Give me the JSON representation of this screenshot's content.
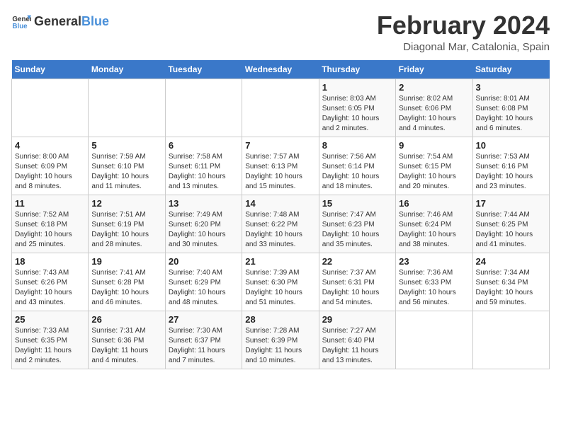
{
  "logo": {
    "general": "General",
    "blue": "Blue"
  },
  "title": "February 2024",
  "subtitle": "Diagonal Mar, Catalonia, Spain",
  "days_of_week": [
    "Sunday",
    "Monday",
    "Tuesday",
    "Wednesday",
    "Thursday",
    "Friday",
    "Saturday"
  ],
  "weeks": [
    [
      {
        "day": "",
        "info": ""
      },
      {
        "day": "",
        "info": ""
      },
      {
        "day": "",
        "info": ""
      },
      {
        "day": "",
        "info": ""
      },
      {
        "day": "1",
        "info": "Sunrise: 8:03 AM\nSunset: 6:05 PM\nDaylight: 10 hours\nand 2 minutes."
      },
      {
        "day": "2",
        "info": "Sunrise: 8:02 AM\nSunset: 6:06 PM\nDaylight: 10 hours\nand 4 minutes."
      },
      {
        "day": "3",
        "info": "Sunrise: 8:01 AM\nSunset: 6:08 PM\nDaylight: 10 hours\nand 6 minutes."
      }
    ],
    [
      {
        "day": "4",
        "info": "Sunrise: 8:00 AM\nSunset: 6:09 PM\nDaylight: 10 hours\nand 8 minutes."
      },
      {
        "day": "5",
        "info": "Sunrise: 7:59 AM\nSunset: 6:10 PM\nDaylight: 10 hours\nand 11 minutes."
      },
      {
        "day": "6",
        "info": "Sunrise: 7:58 AM\nSunset: 6:11 PM\nDaylight: 10 hours\nand 13 minutes."
      },
      {
        "day": "7",
        "info": "Sunrise: 7:57 AM\nSunset: 6:13 PM\nDaylight: 10 hours\nand 15 minutes."
      },
      {
        "day": "8",
        "info": "Sunrise: 7:56 AM\nSunset: 6:14 PM\nDaylight: 10 hours\nand 18 minutes."
      },
      {
        "day": "9",
        "info": "Sunrise: 7:54 AM\nSunset: 6:15 PM\nDaylight: 10 hours\nand 20 minutes."
      },
      {
        "day": "10",
        "info": "Sunrise: 7:53 AM\nSunset: 6:16 PM\nDaylight: 10 hours\nand 23 minutes."
      }
    ],
    [
      {
        "day": "11",
        "info": "Sunrise: 7:52 AM\nSunset: 6:18 PM\nDaylight: 10 hours\nand 25 minutes."
      },
      {
        "day": "12",
        "info": "Sunrise: 7:51 AM\nSunset: 6:19 PM\nDaylight: 10 hours\nand 28 minutes."
      },
      {
        "day": "13",
        "info": "Sunrise: 7:49 AM\nSunset: 6:20 PM\nDaylight: 10 hours\nand 30 minutes."
      },
      {
        "day": "14",
        "info": "Sunrise: 7:48 AM\nSunset: 6:22 PM\nDaylight: 10 hours\nand 33 minutes."
      },
      {
        "day": "15",
        "info": "Sunrise: 7:47 AM\nSunset: 6:23 PM\nDaylight: 10 hours\nand 35 minutes."
      },
      {
        "day": "16",
        "info": "Sunrise: 7:46 AM\nSunset: 6:24 PM\nDaylight: 10 hours\nand 38 minutes."
      },
      {
        "day": "17",
        "info": "Sunrise: 7:44 AM\nSunset: 6:25 PM\nDaylight: 10 hours\nand 41 minutes."
      }
    ],
    [
      {
        "day": "18",
        "info": "Sunrise: 7:43 AM\nSunset: 6:26 PM\nDaylight: 10 hours\nand 43 minutes."
      },
      {
        "day": "19",
        "info": "Sunrise: 7:41 AM\nSunset: 6:28 PM\nDaylight: 10 hours\nand 46 minutes."
      },
      {
        "day": "20",
        "info": "Sunrise: 7:40 AM\nSunset: 6:29 PM\nDaylight: 10 hours\nand 48 minutes."
      },
      {
        "day": "21",
        "info": "Sunrise: 7:39 AM\nSunset: 6:30 PM\nDaylight: 10 hours\nand 51 minutes."
      },
      {
        "day": "22",
        "info": "Sunrise: 7:37 AM\nSunset: 6:31 PM\nDaylight: 10 hours\nand 54 minutes."
      },
      {
        "day": "23",
        "info": "Sunrise: 7:36 AM\nSunset: 6:33 PM\nDaylight: 10 hours\nand 56 minutes."
      },
      {
        "day": "24",
        "info": "Sunrise: 7:34 AM\nSunset: 6:34 PM\nDaylight: 10 hours\nand 59 minutes."
      }
    ],
    [
      {
        "day": "25",
        "info": "Sunrise: 7:33 AM\nSunset: 6:35 PM\nDaylight: 11 hours\nand 2 minutes."
      },
      {
        "day": "26",
        "info": "Sunrise: 7:31 AM\nSunset: 6:36 PM\nDaylight: 11 hours\nand 4 minutes."
      },
      {
        "day": "27",
        "info": "Sunrise: 7:30 AM\nSunset: 6:37 PM\nDaylight: 11 hours\nand 7 minutes."
      },
      {
        "day": "28",
        "info": "Sunrise: 7:28 AM\nSunset: 6:39 PM\nDaylight: 11 hours\nand 10 minutes."
      },
      {
        "day": "29",
        "info": "Sunrise: 7:27 AM\nSunset: 6:40 PM\nDaylight: 11 hours\nand 13 minutes."
      },
      {
        "day": "",
        "info": ""
      },
      {
        "day": "",
        "info": ""
      }
    ]
  ]
}
